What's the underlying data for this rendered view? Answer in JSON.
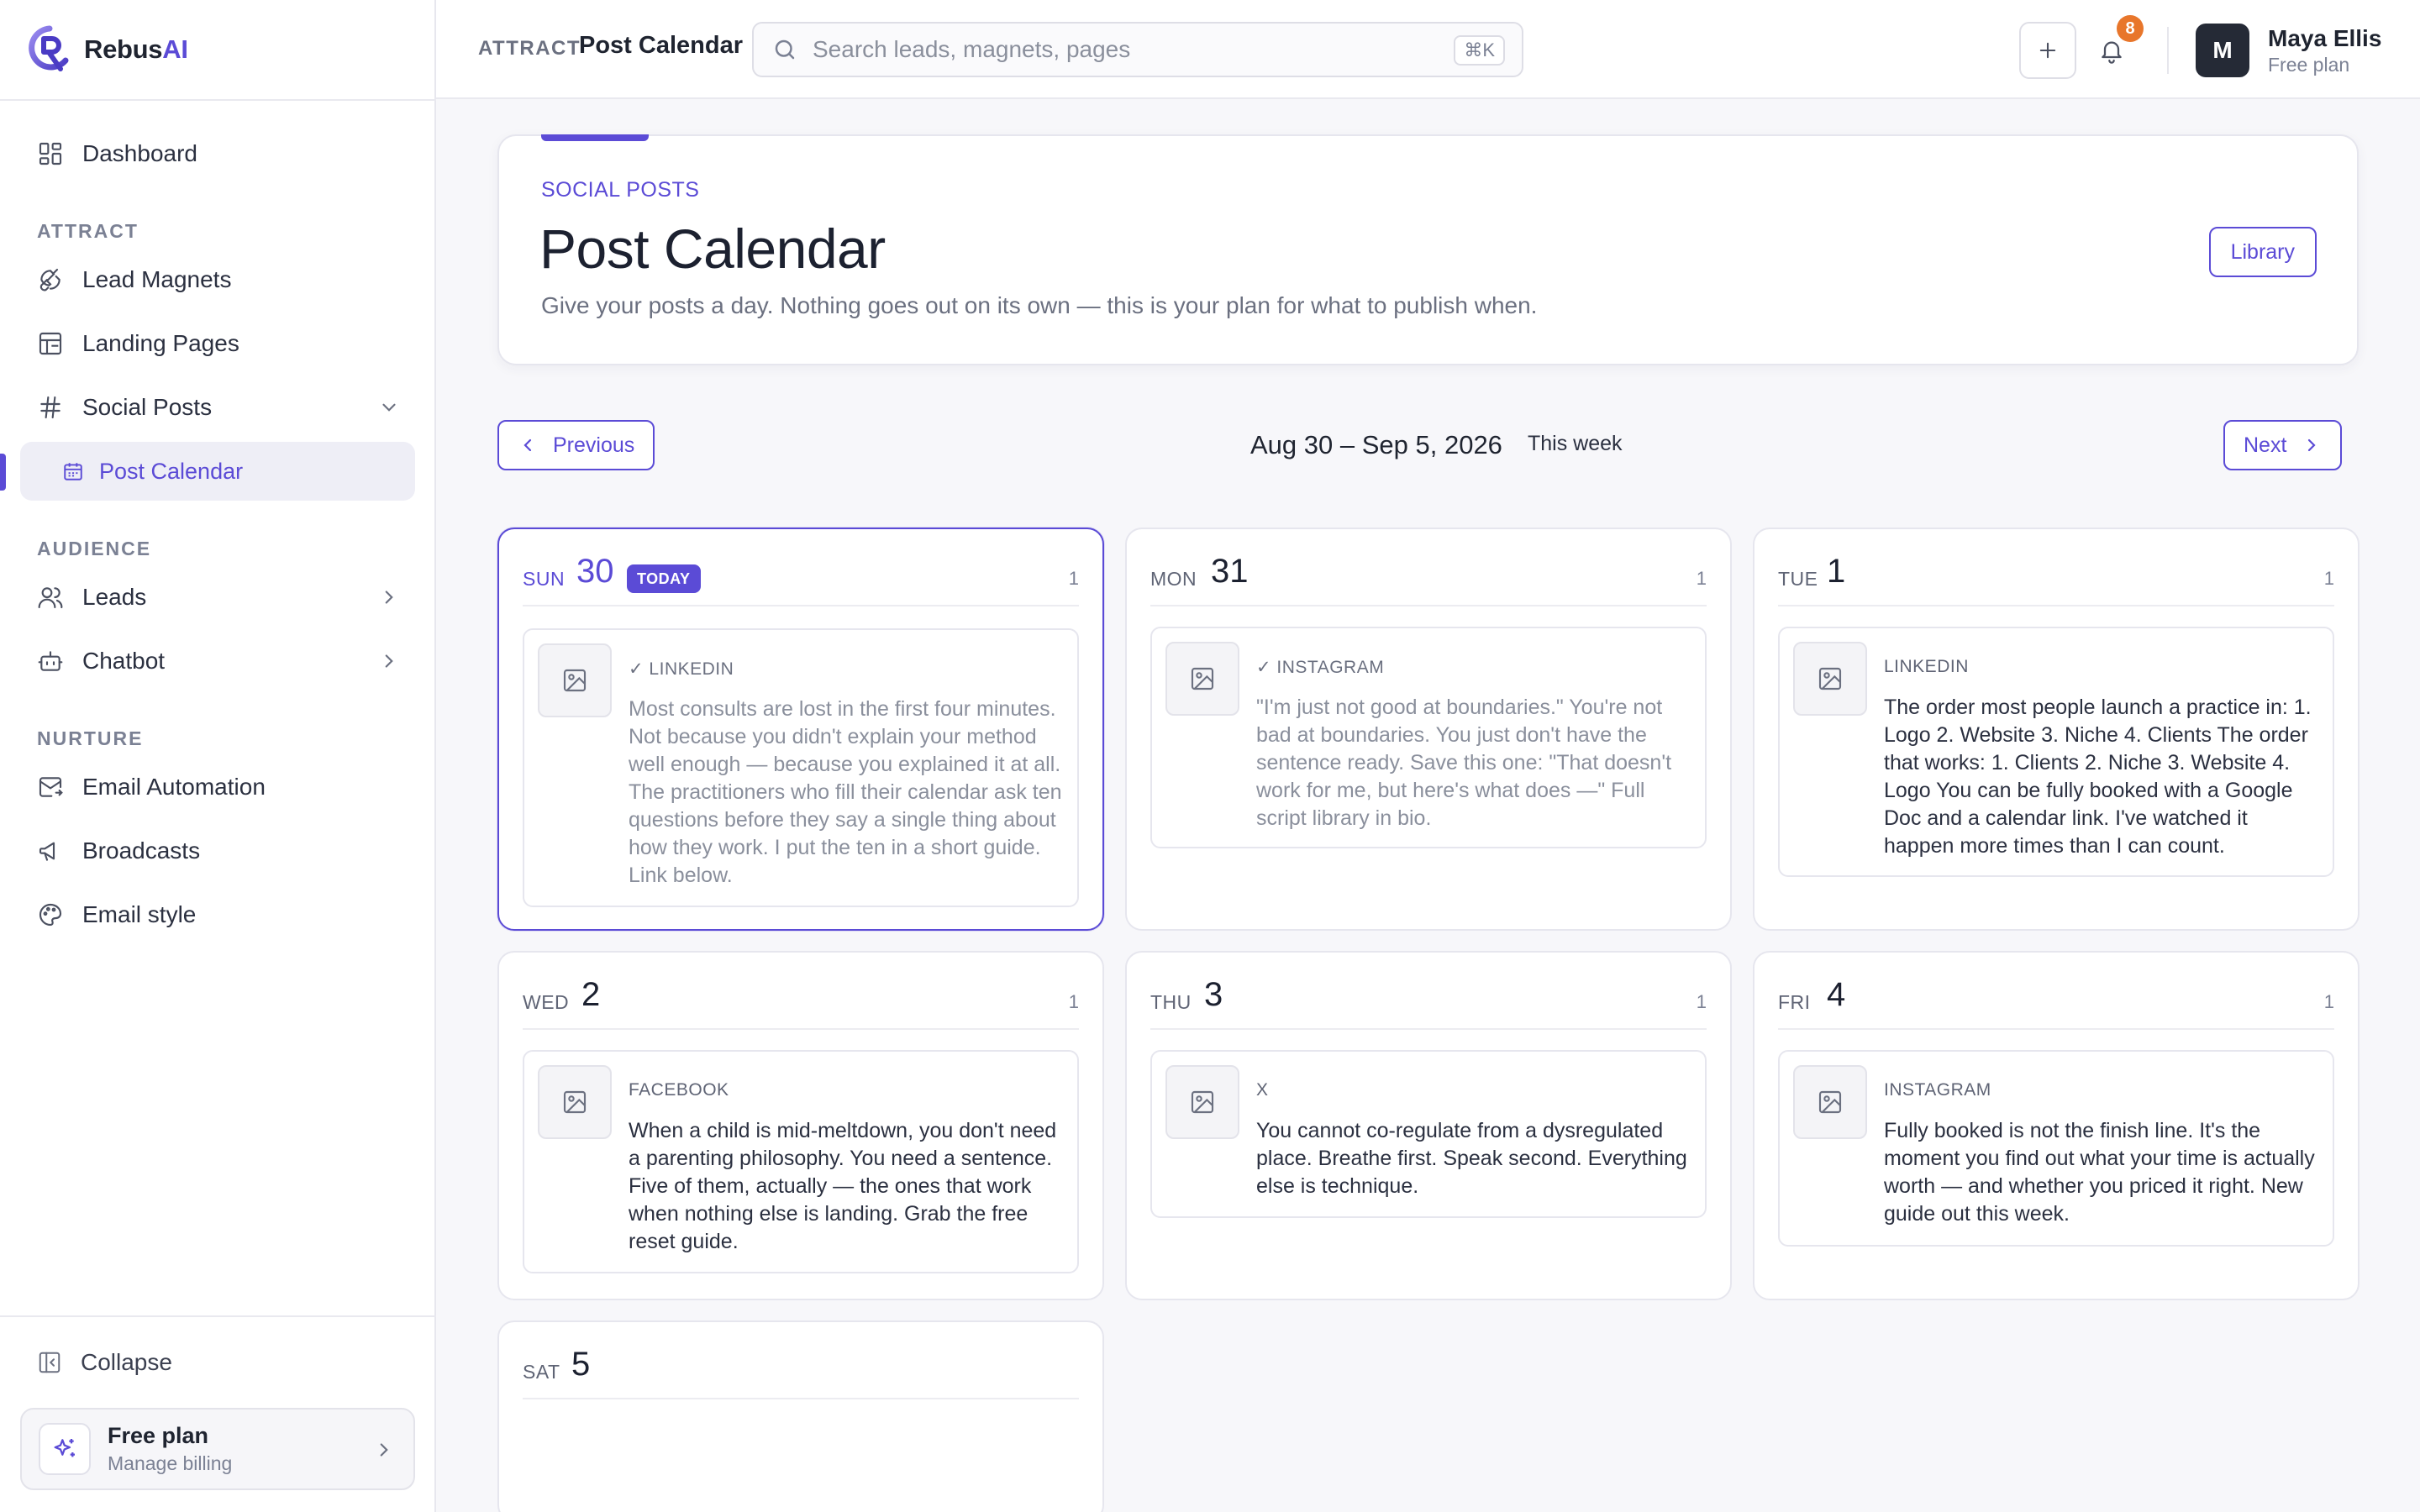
{
  "app": {
    "brand_main": "Rebus",
    "brand_accent": "AI"
  },
  "sidebar": {
    "dashboard": "Dashboard",
    "sections": {
      "attract": "ATTRACT",
      "audience": "AUDIENCE",
      "nurture": "NURTURE"
    },
    "items": {
      "lead_magnets": "Lead Magnets",
      "landing_pages": "Landing Pages",
      "social_posts": "Social Posts",
      "post_calendar": "Post Calendar",
      "leads": "Leads",
      "chatbot": "Chatbot",
      "email_automation": "Email Automation",
      "broadcasts": "Broadcasts",
      "email_style": "Email style"
    },
    "collapse": "Collapse",
    "plan": {
      "title": "Free plan",
      "subtitle": "Manage billing"
    }
  },
  "topbar": {
    "section": "ATTRACT",
    "title": "Post Calendar",
    "search_placeholder": "Search leads, magnets, pages",
    "shortcut": "⌘K",
    "notifications_count": "8",
    "user": {
      "initial": "M",
      "name": "Maya Ellis",
      "plan": "Free plan"
    }
  },
  "header": {
    "kicker": "SOCIAL POSTS",
    "title": "Post Calendar",
    "description": "Give your posts a day. Nothing goes out on its own — this is your plan for what to publish when.",
    "library_label": "Library"
  },
  "week": {
    "previous": "Previous",
    "next": "Next",
    "range": "Aug 30 – Sep 5, 2026",
    "label": "This week"
  },
  "days": [
    {
      "dow": "SUN",
      "num": "30",
      "badge": "TODAY",
      "count": "1",
      "post": {
        "network": "✓ LINKEDIN",
        "posted": true,
        "text": "Most consults are lost in the first four minutes. Not because you didn't explain your method well enough — because you explained it at all. The practitioners who fill their calendar ask ten questions before they say a single thing about how they work. I put the ten in a short guide. Link below."
      }
    },
    {
      "dow": "MON",
      "num": "31",
      "count": "1",
      "post": {
        "network": "✓ INSTAGRAM",
        "posted": true,
        "text": "\"I'm just not good at boundaries.\" You're not bad at boundaries. You just don't have the sentence ready. Save this one: \"That doesn't work for me, but here's what does —\" Full script library in bio."
      }
    },
    {
      "dow": "TUE",
      "num": "1",
      "count": "1",
      "post": {
        "network": "LINKEDIN",
        "posted": false,
        "text": "The order most people launch a practice in: 1. Logo 2. Website 3. Niche 4. Clients The order that works: 1. Clients 2. Niche 3. Website 4. Logo You can be fully booked with a Google Doc and a calendar link. I've watched it happen more times than I can count."
      }
    },
    {
      "dow": "WED",
      "num": "2",
      "count": "1",
      "post": {
        "network": "FACEBOOK",
        "posted": false,
        "text": "When a child is mid-meltdown, you don't need a parenting philosophy. You need a sentence. Five of them, actually — the ones that work when nothing else is landing. Grab the free reset guide."
      }
    },
    {
      "dow": "THU",
      "num": "3",
      "count": "1",
      "post": {
        "network": "X",
        "posted": false,
        "text": "You cannot co-regulate from a dysregulated place. Breathe first. Speak second. Everything else is technique."
      }
    },
    {
      "dow": "FRI",
      "num": "4",
      "count": "1",
      "post": {
        "network": "INSTAGRAM",
        "posted": false,
        "text": "Fully booked is not the finish line. It's the moment you find out what your time is actually worth — and whether you priced it right. New guide out this week."
      }
    },
    {
      "dow": "SAT",
      "num": "5"
    }
  ],
  "colors": {
    "accent": "#5b4bd6",
    "badge": "#e8762b"
  }
}
